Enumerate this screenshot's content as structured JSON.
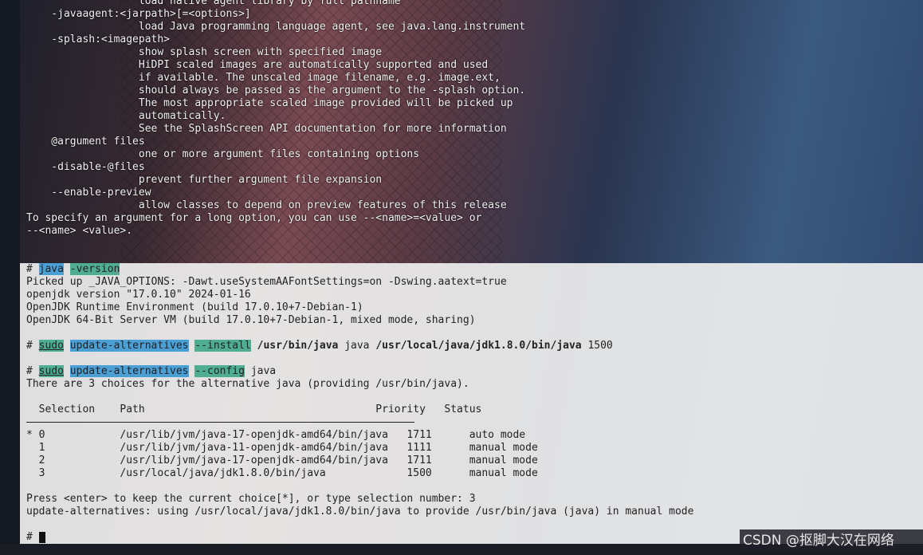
{
  "terminal_top": [
    "                  load native agent library by full pathname",
    "    -javaagent:<jarpath>[=<options>]",
    "                  load Java programming language agent, see java.lang.instrument",
    "    -splash:<imagepath>",
    "                  show splash screen with specified image",
    "                  HiDPI scaled images are automatically supported and used",
    "                  if available. The unscaled image filename, e.g. image.ext,",
    "                  should always be passed as the argument to the -splash option.",
    "                  The most appropriate scaled image provided will be picked up",
    "                  automatically.",
    "                  See the SplashScreen API documentation for more information",
    "    @argument files",
    "                  one or more argument files containing options",
    "    -disable-@files",
    "                  prevent further argument file expansion",
    "    --enable-preview",
    "                  allow classes to depend on preview features of this release",
    "To specify an argument for a long option, you can use --<name>=<value> or",
    "--<name> <value>."
  ],
  "terminal_bottom": [
    [
      {
        "t": "# "
      },
      {
        "t": "java",
        "c": "hl-blue"
      },
      {
        "t": " "
      },
      {
        "t": "-version",
        "c": "hl-teal"
      }
    ],
    [
      {
        "t": "Picked up _JAVA_OPTIONS: -Dawt.useSystemAAFontSettings=on -Dswing.aatext=true"
      }
    ],
    [
      {
        "t": "openjdk version \"17.0.10\" 2024-01-16"
      }
    ],
    [
      {
        "t": "OpenJDK Runtime Environment (build 17.0.10+7-Debian-1)"
      }
    ],
    [
      {
        "t": "OpenJDK 64-Bit Server VM (build 17.0.10+7-Debian-1, mixed mode, sharing)"
      }
    ],
    [
      {
        "t": ""
      }
    ],
    [
      {
        "t": "# "
      },
      {
        "t": "sudo",
        "c": "hl-teal ul"
      },
      {
        "t": " "
      },
      {
        "t": "update-alternatives",
        "c": "hl-blue"
      },
      {
        "t": " "
      },
      {
        "t": "--install",
        "c": "hl-teal"
      },
      {
        "t": " "
      },
      {
        "t": "/usr/bin/java",
        "c": "bold"
      },
      {
        "t": " java "
      },
      {
        "t": "/usr/local/java/jdk1.8.0/bin/java",
        "c": "bold"
      },
      {
        "t": " 1500"
      }
    ],
    [
      {
        "t": ""
      }
    ],
    [
      {
        "t": "# "
      },
      {
        "t": "sudo",
        "c": "hl-teal ul"
      },
      {
        "t": " "
      },
      {
        "t": "update-alternatives",
        "c": "hl-blue"
      },
      {
        "t": " "
      },
      {
        "t": "--config",
        "c": "hl-teal"
      },
      {
        "t": " java"
      }
    ],
    [
      {
        "t": "There are 3 choices for the alternative java (providing /usr/bin/java)."
      }
    ],
    [
      {
        "t": ""
      }
    ],
    [
      {
        "t": "  Selection    Path                                     Priority   Status"
      }
    ],
    [
      {
        "t": ""
      }
    ],
    [
      {
        "t": "* 0            /usr/lib/jvm/java-17-openjdk-amd64/bin/java   1711      auto mode"
      }
    ],
    [
      {
        "t": "  1            /usr/lib/jvm/java-11-openjdk-amd64/bin/java   1111      manual mode"
      }
    ],
    [
      {
        "t": "  2            /usr/lib/jvm/java-17-openjdk-amd64/bin/java   1711      manual mode"
      }
    ],
    [
      {
        "t": "  3            /usr/local/java/jdk1.8.0/bin/java             1500      manual mode"
      }
    ],
    [
      {
        "t": ""
      }
    ],
    [
      {
        "t": "Press <enter> to keep the current choice[*], or type selection number: 3"
      }
    ],
    [
      {
        "t": "update-alternatives: using /usr/local/java/jdk1.8.0/bin/java to provide /usr/bin/java (java) in manual mode"
      }
    ],
    [
      {
        "t": ""
      }
    ],
    [
      {
        "t": "# "
      }
    ]
  ],
  "watermark": "CSDN @抠脚大汉在网络"
}
